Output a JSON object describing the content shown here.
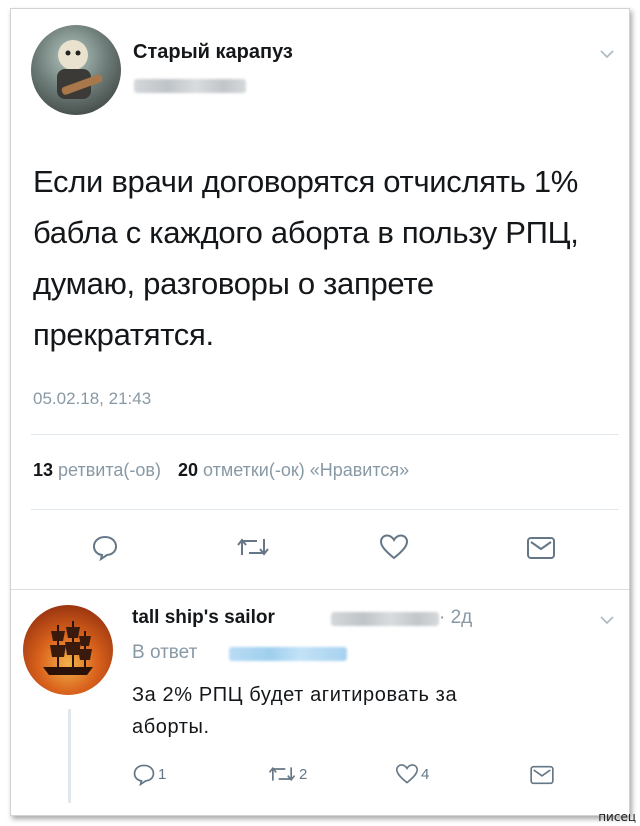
{
  "tweet": {
    "author_name": "Старый карапуз",
    "text": "Если врачи договорятся отчислять 1% бабла с каждого аборта в пользу РПЦ, думаю, разговоры о запрете прекратятся.",
    "timestamp": "05.02.18, 21:43",
    "retweet_count": "13",
    "retweet_label": "ретвита(-ов)",
    "like_count": "20",
    "like_label": "отметки(-ок) «Нравится»"
  },
  "reply": {
    "author_name": "tall ship's sailor",
    "time_ago": "· 2д",
    "reply_to_label": "В ответ",
    "text_line1": "За 2% РПЦ будет агитировать за",
    "text_line2": "аборты.",
    "reply_count": "1",
    "retweet_count": "2",
    "like_count": "4"
  },
  "watermark": "писец",
  "colors": {
    "link_blue": "#1da1f2",
    "muted": "#8899a6",
    "icon": "#657786"
  }
}
